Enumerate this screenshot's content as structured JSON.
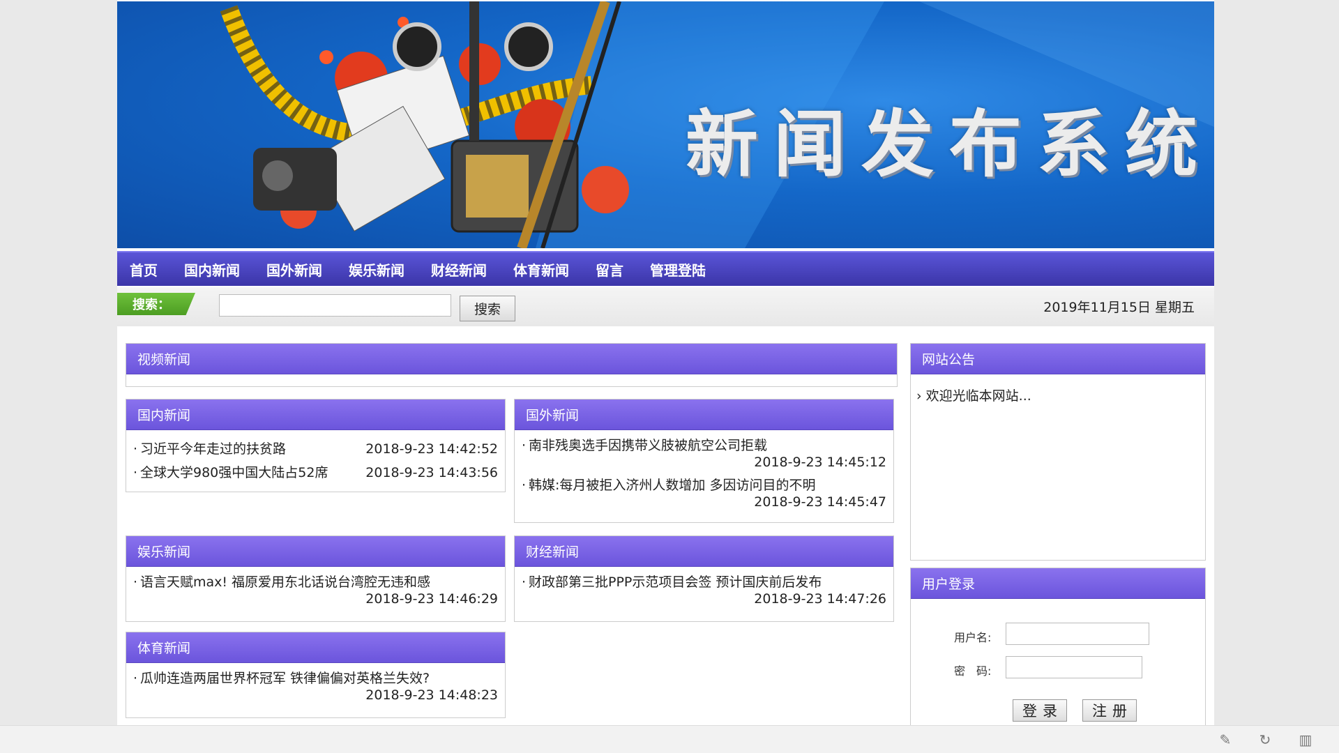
{
  "banner": {
    "title": "新闻发布系统"
  },
  "nav": {
    "items": [
      "首页",
      "国内新闻",
      "国外新闻",
      "娱乐新闻",
      "财经新闻",
      "体育新闻",
      "留言",
      "管理登陆"
    ]
  },
  "search": {
    "label": "搜索：",
    "button": "搜索",
    "value": "",
    "date": "2019年11月15日 星期五"
  },
  "sections": {
    "video": {
      "title": "视频新闻"
    },
    "domestic": {
      "title": "国内新闻",
      "items": [
        {
          "text": "习近平今年走过的扶贫路",
          "time": "2018-9-23 14:42:52"
        },
        {
          "text": "全球大学980强中国大陆占52席",
          "time": "2018-9-23 14:43:56"
        }
      ]
    },
    "foreign": {
      "title": "国外新闻",
      "items": [
        {
          "text": "南非残奥选手因携带义肢被航空公司拒载",
          "time": "2018-9-23 14:45:12"
        },
        {
          "text": "韩媒:每月被拒入济州人数增加 多因访问目的不明",
          "time": "2018-9-23 14:45:47"
        }
      ]
    },
    "entertainment": {
      "title": "娱乐新闻",
      "items": [
        {
          "text": "语言天赋max! 福原爱用东北话说台湾腔无违和感",
          "time": "2018-9-23 14:46:29"
        }
      ]
    },
    "finance": {
      "title": "财经新闻",
      "items": [
        {
          "text": "财政部第三批PPP示范项目会签 预计国庆前后发布",
          "time": "2018-9-23 14:47:26"
        }
      ]
    },
    "sports": {
      "title": "体育新闻",
      "items": [
        {
          "text": "瓜帅连造两届世界杯冠军 铁律偏偏对英格兰失效?",
          "time": "2018-9-23 14:48:23"
        }
      ]
    }
  },
  "notice": {
    "title": "网站公告",
    "items": [
      "欢迎光临本网站..."
    ]
  },
  "login": {
    "title": "用户登录",
    "username_label": "用户名:",
    "password_label": "密　码:",
    "login_button": "登录",
    "register_button": "注册"
  },
  "toolbar_icons": [
    "pin-icon",
    "refresh-icon",
    "trash-icon"
  ]
}
